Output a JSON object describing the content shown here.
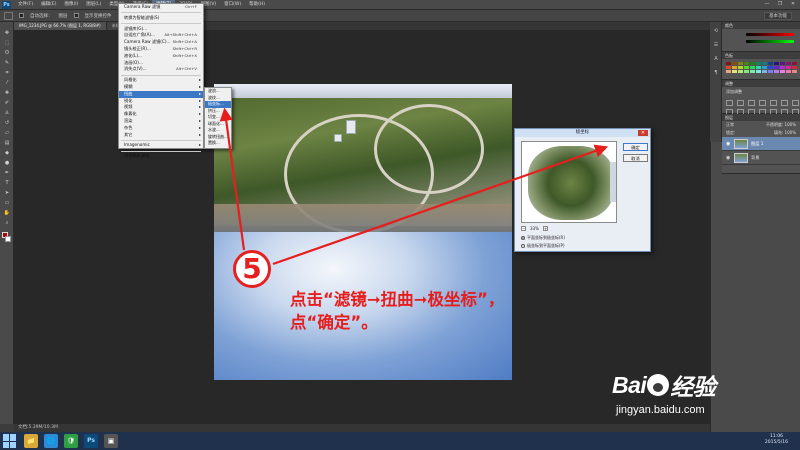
{
  "app": {
    "logo": "Ps",
    "menu": [
      "文件(F)",
      "编辑(E)",
      "图像(I)",
      "图层(L)",
      "类型(Y)",
      "选择(S)",
      "滤镜(T)",
      "3D(D)",
      "视图(V)",
      "窗口(W)",
      "帮助(H)"
    ],
    "active_menu_index": 6,
    "window_buttons": [
      "—",
      "❐",
      "✕"
    ]
  },
  "options_bar": {
    "auto_select_label": "自动选择：",
    "auto_select_value": "图层",
    "transform_label": "显示变换控件",
    "workspace": "基本功能"
  },
  "doc_tabs": [
    "IMG_1234.JPG @ 66.7% (图层 1, RGB/8#)",
    "未标题-1 @ 66.7%"
  ],
  "status_bar": "文档:5.39M/10.3M",
  "filter_menu": {
    "items": [
      {
        "label": "Camera Raw 滤镜",
        "shortcut": "Ctrl+F"
      },
      {
        "sep": true
      },
      {
        "label": "转换为智能滤镜(S)"
      },
      {
        "sep": true
      },
      {
        "label": "滤镜库(G)..."
      },
      {
        "label": "自适应广角(A)...",
        "shortcut": "Alt+Shift+Ctrl+A"
      },
      {
        "label": "Camera Raw 滤镜(C)...",
        "shortcut": "Shift+Ctrl+A"
      },
      {
        "label": "镜头校正(R)...",
        "shortcut": "Shift+Ctrl+R"
      },
      {
        "label": "液化(L)...",
        "shortcut": "Shift+Ctrl+X"
      },
      {
        "label": "油画(O)..."
      },
      {
        "label": "消失点(V)...",
        "shortcut": "Alt+Ctrl+V"
      },
      {
        "sep": true
      },
      {
        "label": "风格化",
        "sub": true
      },
      {
        "label": "模糊",
        "sub": true
      },
      {
        "label": "扭曲",
        "sub": true,
        "selected": true
      },
      {
        "label": "锐化",
        "sub": true
      },
      {
        "label": "视频",
        "sub": true
      },
      {
        "label": "像素化",
        "sub": true
      },
      {
        "label": "渲染",
        "sub": true
      },
      {
        "label": "杂色",
        "sub": true
      },
      {
        "label": "其它",
        "sub": true
      },
      {
        "sep": true
      },
      {
        "label": "Imagenomic",
        "sub": true
      },
      {
        "sep": true
      },
      {
        "label": "浏览联机滤镜..."
      }
    ]
  },
  "distort_submenu": {
    "items": [
      {
        "label": "波浪..."
      },
      {
        "label": "波纹..."
      },
      {
        "label": "极坐标...",
        "selected": true
      },
      {
        "label": "挤压..."
      },
      {
        "label": "切变..."
      },
      {
        "label": "球面化..."
      },
      {
        "label": "水波..."
      },
      {
        "label": "旋转扭曲..."
      },
      {
        "label": "置换..."
      }
    ]
  },
  "dialog": {
    "title": "极坐标",
    "close": "✕",
    "ok": "确定",
    "cancel": "取消",
    "zoom_minus": "−",
    "zoom_plus": "+",
    "zoom_value": "33%",
    "radio_1": "平面坐标到极坐标(R)",
    "radio_2": "极坐标到平面坐标(P)"
  },
  "right_panel": {
    "color_tab": "颜色",
    "swatches_tab": "色板",
    "adjust_tab": "调整",
    "add_adjust": "添加调整",
    "layers_tab": "图层",
    "kind_label": "类型",
    "blend_mode": "正常",
    "opacity": "不透明度: 100%",
    "lock_label": "锁定:",
    "fill": "填充: 100%",
    "layers": [
      {
        "name": "图层 1",
        "selected": true
      },
      {
        "name": "背景",
        "selected": false
      }
    ]
  },
  "annotation": {
    "step_number": "5",
    "line1": "点击“滤镜➞扭曲➞极坐标”，",
    "line2": "点“确定”。"
  },
  "watermark": {
    "logo_left": "Bai",
    "logo_right": "经验",
    "url": "jingyan.baidu.com"
  },
  "taskbar": {
    "apps": [
      "📁",
      "🌐",
      "🛡",
      "Ps",
      "▣"
    ],
    "time": "11:06",
    "date": "2015/5/16"
  },
  "colors": {
    "annotation_red": "#e61e1e",
    "menu_highlight": "#3a78c6",
    "taskbar": "#20314d"
  }
}
